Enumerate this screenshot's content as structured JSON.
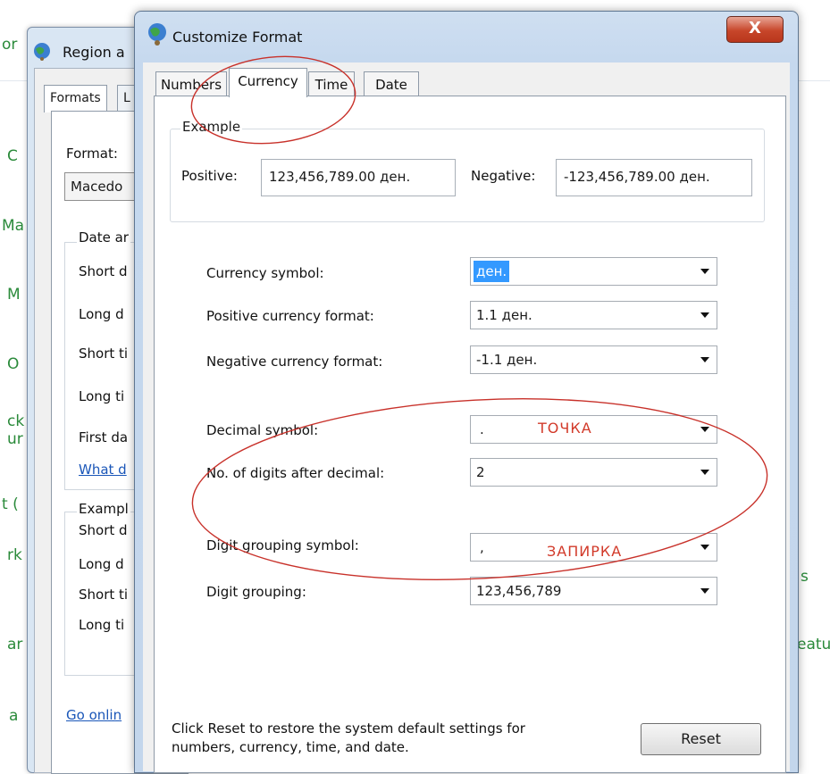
{
  "background": {
    "left_items": [
      "or",
      "C",
      "Ma",
      "M",
      "O",
      "ck",
      "ur",
      "t (",
      "rk",
      "ar",
      "a"
    ],
    "right_items": [
      "s",
      "eatu"
    ]
  },
  "region_window": {
    "title": "Region a",
    "tabs": [
      "Formats",
      "L"
    ],
    "format_label": "Format:",
    "format_value": "Macedo",
    "date_group_label": "Date ar",
    "rows": [
      "Short d",
      "Long d",
      "Short ti",
      "Long ti",
      "First da"
    ],
    "what_link": "What d",
    "examples_label": "Exampl",
    "example_rows": [
      "Short d",
      "Long d",
      "Short ti",
      "Long ti"
    ],
    "go_online_link": "Go onlin"
  },
  "dialog": {
    "title": "Customize Format",
    "close_label": "X",
    "tabs": [
      {
        "label": "Numbers",
        "active": false
      },
      {
        "label": "Currency",
        "active": true
      },
      {
        "label": "Time",
        "active": false
      },
      {
        "label": "Date",
        "active": false
      }
    ],
    "example": {
      "group_label": "Example",
      "positive_label": "Positive:",
      "positive_value": "123,456,789.00 ден.",
      "negative_label": "Negative:",
      "negative_value": "-123,456,789.00 ден."
    },
    "fields": [
      {
        "label": "Currency symbol:",
        "value": "ден."
      },
      {
        "label": "Positive currency format:",
        "value": "1.1 ден."
      },
      {
        "label": "Negative currency format:",
        "value": "-1.1 ден."
      },
      {
        "label": "Decimal symbol:",
        "value": "."
      },
      {
        "label": "No. of digits after decimal:",
        "value": "2"
      },
      {
        "label": "Digit grouping symbol:",
        "value": ","
      },
      {
        "label": "Digit grouping:",
        "value": "123,456,789"
      }
    ],
    "annotations": {
      "decimal_note": "ТОЧКА",
      "grouping_note": "ЗАПИРКА"
    },
    "footer_text": "Click Reset to restore the system default settings for numbers, currency, time, and date.",
    "reset_label": "Reset"
  },
  "colors": {
    "annotation": "#d23a2a",
    "link": "#1a56b8",
    "selection": "#3399ff",
    "background_link_green": "#2a8a3a"
  }
}
